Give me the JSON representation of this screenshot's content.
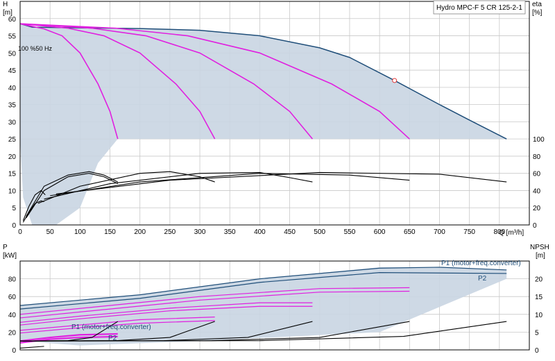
{
  "chart_data": [
    {
      "type": "line",
      "panel": "head-efficiency",
      "title": "Hydro MPC-F 5 CR 125-2-1",
      "annotation": "100 %50 Hz",
      "ylabel": "H",
      "yunit": "[m]",
      "y2label": "eta",
      "y2unit": "[%]",
      "xlabel": "Q [m³/h]",
      "xlim": [
        0,
        850
      ],
      "ylim": [
        0,
        65
      ],
      "y2lim": [
        0,
        100
      ],
      "x_ticks": [
        "0",
        "50",
        "100",
        "150",
        "200",
        "250",
        "300",
        "350",
        "400",
        "450",
        "500",
        "550",
        "600",
        "650",
        "700",
        "750",
        "800"
      ],
      "y_ticks": [
        "0",
        "5",
        "10",
        "15",
        "20",
        "25",
        "30",
        "35",
        "40",
        "45",
        "50",
        "55",
        "60"
      ],
      "y2_ticks": [
        "0",
        "20",
        "40",
        "60",
        "80",
        "100"
      ],
      "colors": {
        "envelope": "#2a4f7f",
        "max_curve": "#1f4e79",
        "pump_curves": "#e020e0",
        "eta_curves": "#000000",
        "fill": "#c9d5e2"
      },
      "duty_point": {
        "x": 625,
        "y": 42
      },
      "head_envelope": [
        [
          0,
          58.5
        ],
        [
          20,
          57.5
        ],
        [
          100,
          57.3
        ],
        [
          200,
          57.1
        ],
        [
          300,
          56.6
        ],
        [
          400,
          55.0
        ],
        [
          500,
          51.5
        ],
        [
          550,
          48.7
        ],
        [
          625,
          42.0
        ],
        [
          700,
          35.0
        ],
        [
          750,
          30.5
        ],
        [
          812,
          25.0
        ],
        [
          0,
          25
        ]
      ],
      "head_curves": [
        {
          "pumps": 1,
          "points": [
            [
              0,
              58.5
            ],
            [
              40,
              57.0
            ],
            [
              70,
              55.0
            ],
            [
              100,
              50.0
            ],
            [
              130,
              41.0
            ],
            [
              150,
              33.0
            ],
            [
              163,
              25.0
            ]
          ]
        },
        {
          "pumps": 2,
          "points": [
            [
              0,
              58.5
            ],
            [
              80,
              57.2
            ],
            [
              140,
              55.0
            ],
            [
              200,
              50.0
            ],
            [
              260,
              41.0
            ],
            [
              300,
              33.0
            ],
            [
              325,
              25.0
            ]
          ]
        },
        {
          "pumps": 3,
          "points": [
            [
              0,
              58.5
            ],
            [
              120,
              57.2
            ],
            [
              210,
              55.0
            ],
            [
              300,
              50.0
            ],
            [
              390,
              41.0
            ],
            [
              450,
              33.0
            ],
            [
              488,
              25.0
            ]
          ]
        },
        {
          "pumps": 4,
          "points": [
            [
              0,
              58.5
            ],
            [
              160,
              57.2
            ],
            [
              280,
              55.0
            ],
            [
              400,
              50.0
            ],
            [
              520,
              41.0
            ],
            [
              600,
              33.0
            ],
            [
              650,
              25.0
            ]
          ]
        }
      ],
      "eta_curves": [
        {
          "points": [
            [
              5,
              5
            ],
            [
              15,
              22
            ],
            [
              25,
              35
            ],
            [
              35,
              40
            ],
            [
              42,
              35
            ]
          ]
        },
        {
          "points": [
            [
              5,
              3
            ],
            [
              15,
              15
            ],
            [
              25,
              25
            ],
            [
              35,
              28
            ],
            [
              40,
              27
            ]
          ]
        },
        {
          "points": [
            [
              10,
              10
            ],
            [
              40,
              45
            ],
            [
              80,
              58
            ],
            [
              115,
              62
            ],
            [
              140,
              58
            ],
            [
              163,
              50
            ]
          ]
        },
        {
          "points": [
            [
              10,
              8
            ],
            [
              40,
              40
            ],
            [
              80,
              56
            ],
            [
              115,
              60
            ],
            [
              140,
              56
            ],
            [
              163,
              48
            ]
          ]
        },
        {
          "points": [
            [
              30,
              25
            ],
            [
              100,
              45
            ],
            [
              200,
              60
            ],
            [
              250,
              62
            ],
            [
              300,
              56
            ],
            [
              325,
              50
            ]
          ]
        },
        {
          "points": [
            [
              40,
              30
            ],
            [
              150,
              48
            ],
            [
              300,
              60
            ],
            [
              400,
              61
            ],
            [
              450,
              55
            ],
            [
              488,
              50
            ]
          ]
        },
        {
          "points": [
            [
              50,
              34
            ],
            [
              200,
              50
            ],
            [
              400,
              60
            ],
            [
              550,
              58
            ],
            [
              650,
              52
            ]
          ]
        },
        {
          "points": [
            [
              60,
              36
            ],
            [
              250,
              52
            ],
            [
              500,
              61
            ],
            [
              700,
              59
            ],
            [
              812,
              50
            ]
          ]
        }
      ]
    },
    {
      "type": "line",
      "panel": "power-npsh",
      "ylabel": "P",
      "yunit": "[kW]",
      "y2label": "NPSH",
      "y2unit": "[m]",
      "xlim": [
        0,
        850
      ],
      "ylim": [
        0,
        100
      ],
      "y2lim": [
        0,
        25
      ],
      "y_ticks": [
        "0",
        "20",
        "40",
        "60",
        "80"
      ],
      "y2_ticks": [
        "0",
        "5",
        "10",
        "15",
        "20"
      ],
      "legend": {
        "p1": "P1 (motor+freq.converter)",
        "p2": "P2"
      },
      "power_envelope": [
        [
          0,
          50
        ],
        [
          200,
          62
        ],
        [
          400,
          80
        ],
        [
          600,
          93
        ],
        [
          700,
          93
        ],
        [
          812,
          90
        ],
        [
          812,
          80
        ],
        [
          600,
          20
        ],
        [
          300,
          10
        ],
        [
          100,
          5
        ],
        [
          0,
          10
        ]
      ],
      "p1_curves_blue": [
        {
          "points": [
            [
              0,
              50
            ],
            [
              200,
              62
            ],
            [
              400,
              80
            ],
            [
              600,
              92
            ],
            [
              700,
              93
            ],
            [
              812,
              90
            ]
          ]
        },
        {
          "points": [
            [
              0,
              46
            ],
            [
              200,
              58
            ],
            [
              400,
              76
            ],
            [
              600,
              87
            ],
            [
              812,
              86
            ]
          ]
        }
      ],
      "p1_curves_magenta": [
        {
          "points": [
            [
              0,
              40
            ],
            [
              150,
              50
            ],
            [
              300,
              60
            ],
            [
              500,
              69
            ],
            [
              650,
              70
            ]
          ]
        },
        {
          "points": [
            [
              0,
              36
            ],
            [
              150,
              46
            ],
            [
              300,
              56
            ],
            [
              500,
              65
            ],
            [
              650,
              66
            ]
          ]
        },
        {
          "points": [
            [
              0,
              31
            ],
            [
              100,
              38
            ],
            [
              250,
              47
            ],
            [
              400,
              53
            ],
            [
              488,
              53
            ]
          ]
        },
        {
          "points": [
            [
              0,
              28
            ],
            [
              100,
              35
            ],
            [
              250,
              44
            ],
            [
              400,
              49
            ],
            [
              488,
              49
            ]
          ]
        },
        {
          "points": [
            [
              0,
              22
            ],
            [
              100,
              28
            ],
            [
              200,
              34
            ],
            [
              325,
              37
            ]
          ]
        },
        {
          "points": [
            [
              0,
              19
            ],
            [
              100,
              25
            ],
            [
              200,
              30
            ],
            [
              325,
              33
            ]
          ]
        },
        {
          "points": [
            [
              0,
              10
            ],
            [
              50,
              14
            ],
            [
              100,
              17
            ],
            [
              163,
              18
            ]
          ]
        },
        {
          "points": [
            [
              0,
              8
            ],
            [
              50,
              12
            ],
            [
              100,
              14
            ],
            [
              163,
              15
            ]
          ]
        }
      ],
      "npsh_curves": [
        {
          "points": [
            [
              0,
              0.5
            ],
            [
              40,
              1.0
            ]
          ]
        },
        {
          "points": [
            [
              0,
              2.5
            ],
            [
              80,
              2.6
            ],
            [
              120,
              3.5
            ],
            [
              163,
              8.0
            ]
          ]
        },
        {
          "points": [
            [
              0,
              2.5
            ],
            [
              160,
              2.6
            ],
            [
              250,
              3.5
            ],
            [
              325,
              8.0
            ]
          ]
        },
        {
          "points": [
            [
              0,
              2.5
            ],
            [
              240,
              2.6
            ],
            [
              380,
              3.5
            ],
            [
              488,
              8.0
            ]
          ]
        },
        {
          "points": [
            [
              0,
              2.5
            ],
            [
              320,
              2.6
            ],
            [
              500,
              3.5
            ],
            [
              650,
              8.0
            ]
          ]
        },
        {
          "points": [
            [
              0,
              2.5
            ],
            [
              400,
              2.6
            ],
            [
              640,
              3.8
            ],
            [
              812,
              8.0
            ]
          ]
        }
      ]
    }
  ]
}
